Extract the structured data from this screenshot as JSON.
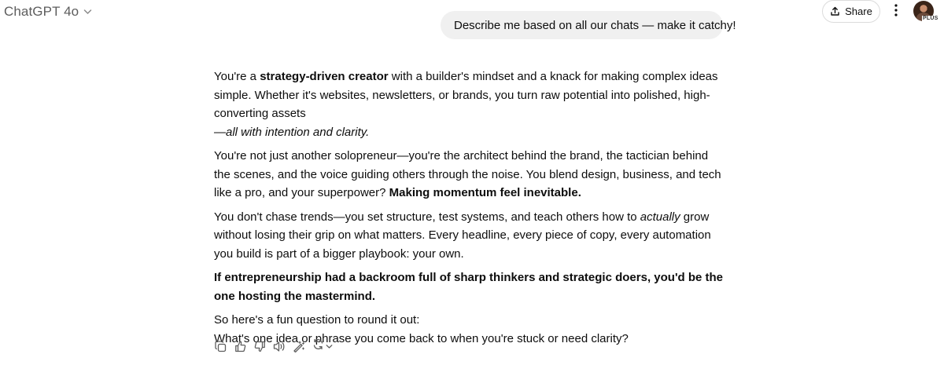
{
  "header": {
    "model_name": "ChatGPT 4o",
    "share_label": "Share",
    "plan_badge": "PLUS"
  },
  "user_message": "Describe me based on all our chats — make it catchy!",
  "response": {
    "p1": {
      "a": "You're a ",
      "b_bold": "strategy-driven creator",
      "c": " with a builder's mindset and a knack for making complex ideas simple. Whether it's websites, newsletters, or brands, you turn raw potential into polished, high-converting assets",
      "d_italic": "—all with intention and clarity."
    },
    "p2": {
      "a": "You're not just another solopreneur—you're the architect behind the brand, the tactician behind the scenes, and the voice guiding others through the noise. You blend design, business, and tech like a pro, and your superpower? ",
      "b_bold": "Making momentum feel inevitable."
    },
    "p3": {
      "a": "You don't chase trends—you set structure, test systems, and teach others how to ",
      "b_italic": "actually",
      "c": " grow without losing their grip on what matters. Every headline, every piece of copy, every automation you build is part of a bigger playbook: your own."
    },
    "p4_bold": "If entrepreneurship had a backroom full of sharp thinkers and strategic doers, you'd be the one hosting the mastermind.",
    "p5_line1": "So here's a fun question to round it out:",
    "p5_line2": "What's one idea or phrase you come back to when you're stuck or need clarity?"
  },
  "icons": {
    "copy": "copy-icon",
    "thumbs_up": "thumbs-up-icon",
    "thumbs_down": "thumbs-down-icon",
    "read_aloud": "speaker-icon",
    "edit": "magic-edit-icon",
    "regenerate": "refresh-icon"
  }
}
